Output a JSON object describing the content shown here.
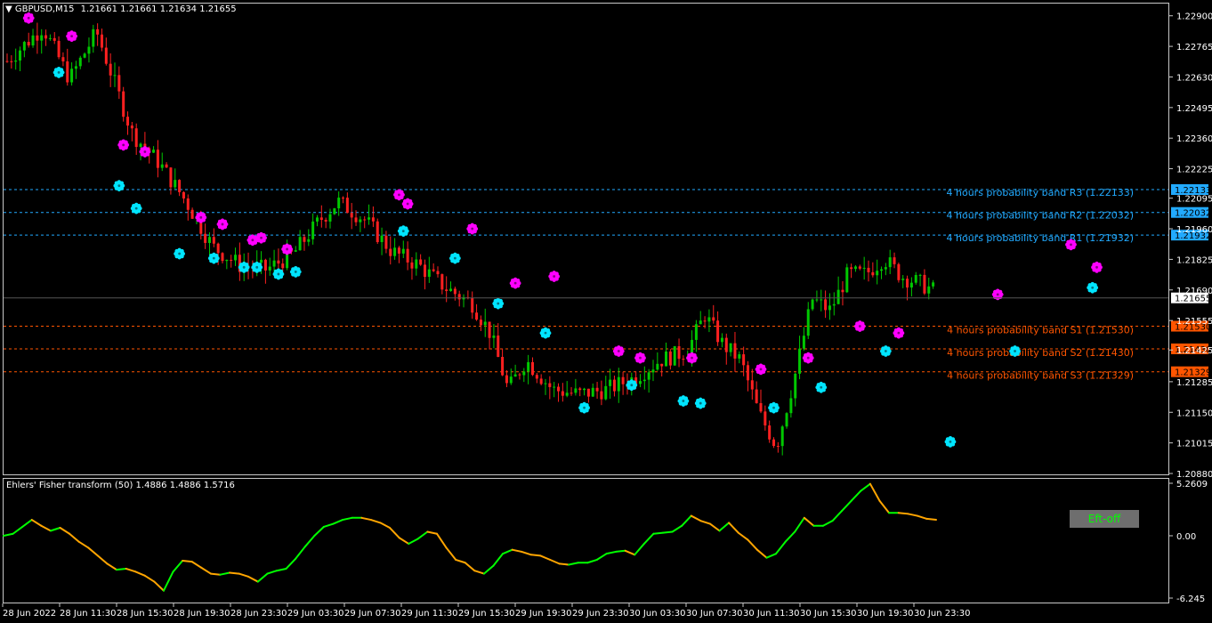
{
  "header": {
    "symbol_label": "GBPUSD,M15",
    "ohlc": "1.21661 1.21661 1.21634 1.21655"
  },
  "indicator": {
    "label": "Ehlers' Fisher transform (50) 1.4886 1.4886 1.5716",
    "button_label": "Eft-off"
  },
  "colors": {
    "background": "#000000",
    "bull": "#00c800",
    "bear": "#ff2020",
    "resistance": "#22aaff",
    "support": "#ff5500",
    "marker_high": "#ff00ff",
    "marker_low": "#00e5ff",
    "fisher_up": "#00ff00",
    "fisher_down": "#ffa500"
  },
  "chart_data": [
    {
      "type": "candlestick",
      "title": "GBPUSD,M15",
      "ylim": [
        1.2088,
        1.2295
      ],
      "y_ticks": [
        "1.22900",
        "1.22765",
        "1.22630",
        "1.22495",
        "1.22360",
        "1.22225",
        "1.22095",
        "1.21960",
        "1.21825",
        "1.21690",
        "1.21555",
        "1.21425",
        "1.21285",
        "1.21150",
        "1.21015",
        "1.20880"
      ],
      "x_ticks": [
        "28 Jun 2022",
        "28 Jun 11:30",
        "28 Jun 15:30",
        "28 Jun 19:30",
        "28 Jun 23:30",
        "29 Jun 03:30",
        "29 Jun 07:30",
        "29 Jun 11:30",
        "29 Jun 15:30",
        "29 Jun 19:30",
        "29 Jun 23:30",
        "30 Jun 03:30",
        "30 Jun 07:30",
        "30 Jun 11:30",
        "30 Jun 15:30",
        "30 Jun 19:30",
        "30 Jun 23:30"
      ],
      "current_price": "1.21655",
      "price_path": [
        [
          0,
          1.227
        ],
        [
          8,
          1.2285
        ],
        [
          14,
          1.2262
        ],
        [
          20,
          1.2283
        ],
        [
          28,
          1.2238
        ],
        [
          34,
          1.2225
        ],
        [
          40,
          1.2208
        ],
        [
          46,
          1.2188
        ],
        [
          52,
          1.218
        ],
        [
          58,
          1.2178
        ],
        [
          64,
          1.2185
        ],
        [
          70,
          1.22
        ],
        [
          74,
          1.2208
        ],
        [
          80,
          1.22
        ],
        [
          86,
          1.2186
        ],
        [
          92,
          1.218
        ],
        [
          98,
          1.217
        ],
        [
          104,
          1.2163
        ],
        [
          108,
          1.215
        ],
        [
          112,
          1.2125
        ],
        [
          116,
          1.2138
        ],
        [
          122,
          1.2125
        ],
        [
          128,
          1.2123
        ],
        [
          134,
          1.2125
        ],
        [
          140,
          1.213
        ],
        [
          146,
          1.2138
        ],
        [
          152,
          1.2142
        ],
        [
          156,
          1.2158
        ],
        [
          160,
          1.2145
        ],
        [
          164,
          1.2138
        ],
        [
          168,
          1.2115
        ],
        [
          172,
          1.21
        ],
        [
          176,
          1.213
        ],
        [
          180,
          1.2165
        ],
        [
          184,
          1.216
        ],
        [
          188,
          1.2176
        ],
        [
          192,
          1.2176
        ],
        [
          196,
          1.2183
        ],
        [
          200,
          1.2175
        ],
        [
          204,
          1.2172
        ],
        [
          208,
          1.2168
        ]
      ],
      "probability_bands": [
        {
          "label": "4 hours probability band R3 (1.22133)",
          "price": "1.22133",
          "value": 1.22133,
          "kind": "resistance"
        },
        {
          "label": "4 hours probability band R2 (1.22032)",
          "price": "1.22032",
          "value": 1.22032,
          "kind": "resistance"
        },
        {
          "label": "4 hours probability band R1 (1.21932)",
          "price": "1.21932",
          "value": 1.21932,
          "kind": "resistance"
        },
        {
          "label": "4 hours probability band S1 (1.21530)",
          "price": "1.21530",
          "value": 1.2153,
          "kind": "support"
        },
        {
          "label": "4 hours probability band S2 (1.21430)",
          "price": "1.21430",
          "value": 1.2143,
          "kind": "support"
        },
        {
          "label": "4 hours probability band S3 (1.21329)",
          "price": "1.21329",
          "value": 1.21329,
          "kind": "support"
        }
      ],
      "markers": [
        {
          "bar": 5,
          "price": 1.2289,
          "kind": "high"
        },
        {
          "bar": 12,
          "price": 1.2265,
          "kind": "low"
        },
        {
          "bar": 15,
          "price": 1.2281,
          "kind": "high"
        },
        {
          "bar": 27,
          "price": 1.2233,
          "kind": "high"
        },
        {
          "bar": 26,
          "price": 1.2215,
          "kind": "low"
        },
        {
          "bar": 32,
          "price": 1.223,
          "kind": "high"
        },
        {
          "bar": 30,
          "price": 1.2205,
          "kind": "low"
        },
        {
          "bar": 45,
          "price": 1.2201,
          "kind": "high"
        },
        {
          "bar": 40,
          "price": 1.2185,
          "kind": "low"
        },
        {
          "bar": 50,
          "price": 1.2198,
          "kind": "high"
        },
        {
          "bar": 48,
          "price": 1.2183,
          "kind": "low"
        },
        {
          "bar": 57,
          "price": 1.2191,
          "kind": "high"
        },
        {
          "bar": 59,
          "price": 1.2192,
          "kind": "high"
        },
        {
          "bar": 55,
          "price": 1.2179,
          "kind": "low"
        },
        {
          "bar": 58,
          "price": 1.2179,
          "kind": "low"
        },
        {
          "bar": 65,
          "price": 1.2187,
          "kind": "high"
        },
        {
          "bar": 63,
          "price": 1.2176,
          "kind": "low"
        },
        {
          "bar": 67,
          "price": 1.2177,
          "kind": "low"
        },
        {
          "bar": 91,
          "price": 1.2211,
          "kind": "high"
        },
        {
          "bar": 93,
          "price": 1.2207,
          "kind": "high"
        },
        {
          "bar": 92,
          "price": 1.2195,
          "kind": "low"
        },
        {
          "bar": 108,
          "price": 1.2196,
          "kind": "high"
        },
        {
          "bar": 104,
          "price": 1.2183,
          "kind": "low"
        },
        {
          "bar": 118,
          "price": 1.2172,
          "kind": "high"
        },
        {
          "bar": 114,
          "price": 1.2163,
          "kind": "low"
        },
        {
          "bar": 127,
          "price": 1.2175,
          "kind": "high"
        },
        {
          "bar": 125,
          "price": 1.215,
          "kind": "low"
        },
        {
          "bar": 134,
          "price": 1.2117,
          "kind": "low"
        },
        {
          "bar": 142,
          "price": 1.2142,
          "kind": "high"
        },
        {
          "bar": 145,
          "price": 1.2127,
          "kind": "low"
        },
        {
          "bar": 147,
          "price": 1.2139,
          "kind": "high"
        },
        {
          "bar": 157,
          "price": 1.212,
          "kind": "low"
        },
        {
          "bar": 159,
          "price": 1.2139,
          "kind": "high"
        },
        {
          "bar": 161,
          "price": 1.2119,
          "kind": "low"
        },
        {
          "bar": 175,
          "price": 1.2134,
          "kind": "high"
        },
        {
          "bar": 178,
          "price": 1.2117,
          "kind": "low"
        },
        {
          "bar": 186,
          "price": 1.2139,
          "kind": "high"
        },
        {
          "bar": 189,
          "price": 1.2126,
          "kind": "low"
        },
        {
          "bar": 198,
          "price": 1.2153,
          "kind": "high"
        },
        {
          "bar": 204,
          "price": 1.2142,
          "kind": "low"
        },
        {
          "bar": 207,
          "price": 1.215,
          "kind": "high"
        },
        {
          "bar": 219,
          "price": 1.2102,
          "kind": "low"
        },
        {
          "bar": 230,
          "price": 1.2167,
          "kind": "high"
        },
        {
          "bar": 234,
          "price": 1.2142,
          "kind": "low"
        },
        {
          "bar": 247,
          "price": 1.2189,
          "kind": "high"
        },
        {
          "bar": 253,
          "price": 1.2179,
          "kind": "high"
        },
        {
          "bar": 252,
          "price": 1.217,
          "kind": "low"
        }
      ]
    },
    {
      "type": "line",
      "title": "Ehlers' Fisher transform (50) 1.4886 1.4886 1.5716",
      "ylim": [
        -6.245,
        5.2609
      ],
      "y_ticks": [
        "5.2609",
        "0.00",
        "-6.245"
      ],
      "values": [
        0.0,
        0.2,
        0.9,
        1.6,
        1.0,
        0.5,
        0.8,
        0.2,
        -0.6,
        -1.2,
        -2.0,
        -2.8,
        -3.4,
        -3.3,
        -3.6,
        -4.0,
        -4.6,
        -5.5,
        -3.6,
        -2.5,
        -2.6,
        -3.2,
        -3.8,
        -3.9,
        -3.7,
        -3.8,
        -4.1,
        -4.6,
        -3.8,
        -3.5,
        -3.3,
        -2.3,
        -1.1,
        0.0,
        0.9,
        1.2,
        1.6,
        1.8,
        1.8,
        1.6,
        1.3,
        0.8,
        -0.2,
        -0.8,
        -0.3,
        0.4,
        0.2,
        -1.2,
        -2.4,
        -2.7,
        -3.5,
        -3.8,
        -3.0,
        -1.8,
        -1.4,
        -1.6,
        -1.9,
        -2.0,
        -2.4,
        -2.8,
        -2.9,
        -2.7,
        -2.7,
        -2.4,
        -1.8,
        -1.6,
        -1.5,
        -1.9,
        -0.8,
        0.2,
        0.3,
        0.4,
        1.0,
        2.0,
        1.5,
        1.2,
        0.5,
        1.3,
        0.3,
        -0.4,
        -1.4,
        -2.2,
        -1.8,
        -0.6,
        0.4,
        1.8,
        1.0,
        1.0,
        1.5,
        2.5,
        3.5,
        4.5,
        5.2,
        3.5,
        2.3,
        2.3,
        2.2,
        2.0,
        1.7,
        1.6
      ]
    }
  ]
}
